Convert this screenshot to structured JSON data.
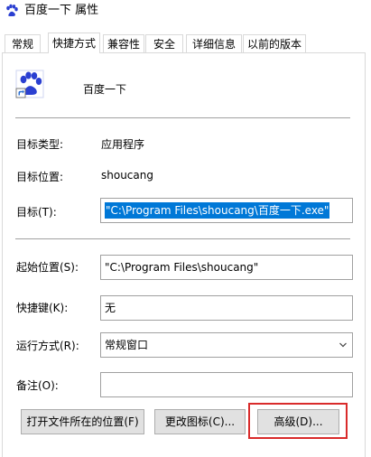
{
  "window": {
    "title": "百度一下 属性",
    "app_icon": "baidu-paw-icon"
  },
  "tabs": [
    {
      "label": "常规"
    },
    {
      "label": "快捷方式",
      "active": true
    },
    {
      "label": "兼容性"
    },
    {
      "label": "安全"
    },
    {
      "label": "详细信息"
    },
    {
      "label": "以前的版本"
    }
  ],
  "shortcut": {
    "name": "百度一下",
    "target_type_label": "目标类型:",
    "target_type_value": "应用程序",
    "target_location_label": "目标位置:",
    "target_location_value": "shoucang",
    "target_label": "目标(T):",
    "target_value": "\"C:\\Program Files\\shoucang\\百度一下.exe\"",
    "start_in_label": "起始位置(S):",
    "start_in_value": "\"C:\\Program Files\\shoucang\"",
    "hotkey_label": "快捷键(K):",
    "hotkey_value": "无",
    "run_label": "运行方式(R):",
    "run_value": "常规窗口",
    "comment_label": "备注(O):",
    "comment_value": ""
  },
  "buttons": {
    "open_location": "打开文件所在的位置(F)",
    "change_icon": "更改图标(C)...",
    "advanced": "高级(D)..."
  },
  "colors": {
    "selection": "#0078d7",
    "highlight_box": "#d92b2b",
    "brand_blue": "#2a3fd1"
  }
}
